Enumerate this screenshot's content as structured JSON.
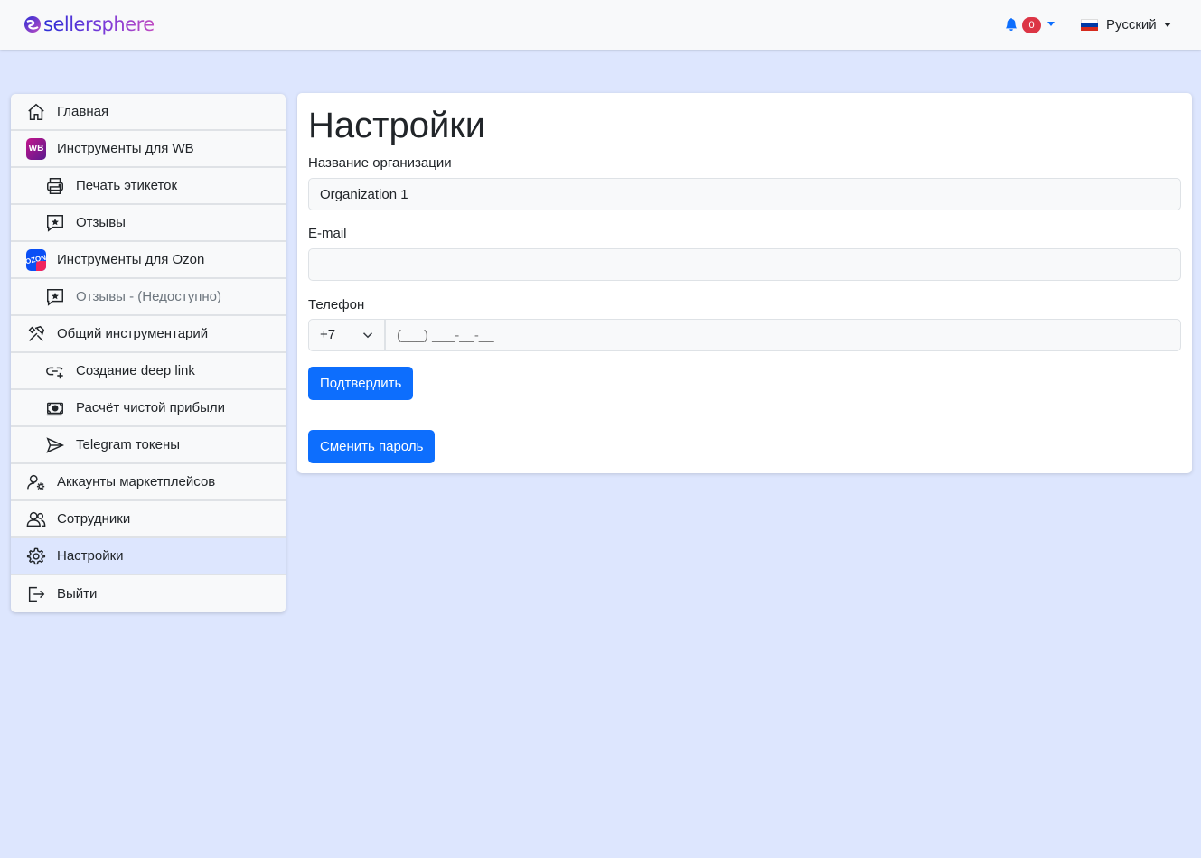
{
  "navbar": {
    "brand": "sellersphere",
    "notifications_count": "0",
    "language": "Русский"
  },
  "sidebar": {
    "items": [
      {
        "label": "Главная",
        "icon": "home-icon"
      },
      {
        "label": "Инструменты для WB",
        "icon": "wb-logo",
        "badge": "WB"
      },
      {
        "label": "Печать этикеток",
        "icon": "printer-icon"
      },
      {
        "label": "Отзывы",
        "icon": "review-star-icon"
      },
      {
        "label": "Инструменты для Ozon",
        "icon": "ozon-logo",
        "badge": "OZON"
      },
      {
        "label": "Отзывы - (Недоступно)",
        "icon": "review-star-icon"
      },
      {
        "label": "Общий инструментарий",
        "icon": "tools-icon"
      },
      {
        "label": "Создание deep link",
        "icon": "link-plus-icon"
      },
      {
        "label": "Расчёт чистой прибыли",
        "icon": "cash-icon"
      },
      {
        "label": "Telegram токены",
        "icon": "send-icon"
      },
      {
        "label": "Аккаунты маркетплейсов",
        "icon": "user-gear-icon"
      },
      {
        "label": "Сотрудники",
        "icon": "people-icon"
      },
      {
        "label": "Настройки",
        "icon": "gear-icon"
      },
      {
        "label": "Выйти",
        "icon": "logout-icon"
      }
    ]
  },
  "settings": {
    "title": "Настройки",
    "org_label": "Название организации",
    "org_value": "Organization 1",
    "email_label": "E-mail",
    "email_value": "",
    "phone_label": "Телефон",
    "phone_code": "+7",
    "phone_placeholder": "(___) ___-__-__",
    "confirm_button": "Подтвердить",
    "change_password_button": "Сменить пароль"
  },
  "colors": {
    "background": "#dde6fe",
    "primary": "#0d6efd",
    "badge": "#dc3545"
  }
}
